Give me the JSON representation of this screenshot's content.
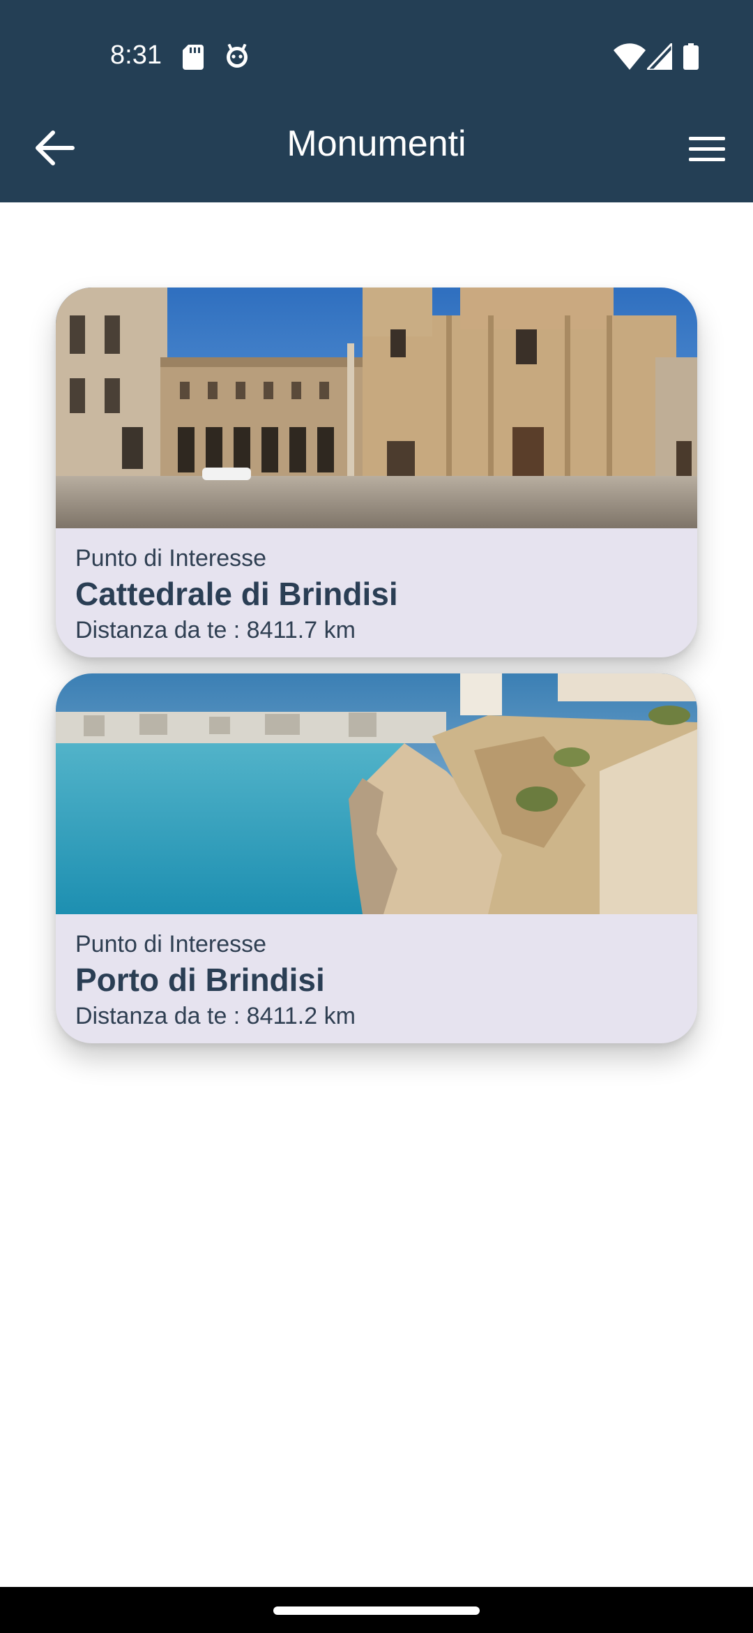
{
  "status_bar": {
    "time": "8:31",
    "icons": [
      "sd-card-icon",
      "bug-icon",
      "wifi-icon",
      "signal-icon",
      "battery-icon"
    ]
  },
  "app_bar": {
    "title": "Monumenti",
    "back_icon": "arrow-left-icon",
    "menu_icon": "hamburger-menu-icon"
  },
  "places": [
    {
      "category": "Punto di Interesse",
      "name": "Cattedrale di Brindisi",
      "distance": "Distanza da te : 8411.7 km"
    },
    {
      "category": "Punto di Interesse",
      "name": "Porto di Brindisi",
      "distance": "Distanza da te : 8411.2 km"
    }
  ],
  "colors": {
    "app_bar": "#243f55",
    "card_background": "#e6e3ef",
    "text": "#2d3e52"
  }
}
